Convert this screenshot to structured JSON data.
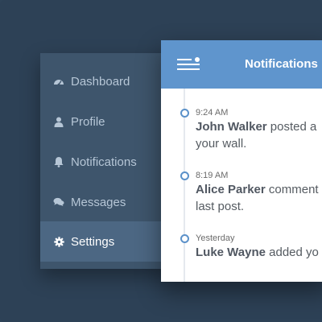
{
  "sidebar": {
    "items": [
      {
        "label": "Dashboard",
        "icon": "dashboard-icon",
        "active": false
      },
      {
        "label": "Profile",
        "icon": "user-icon",
        "active": false
      },
      {
        "label": "Notifications",
        "icon": "bell-icon",
        "active": false
      },
      {
        "label": "Messages",
        "icon": "chat-icon",
        "active": false
      },
      {
        "label": "Settings",
        "icon": "gear-icon",
        "active": true
      }
    ]
  },
  "panel": {
    "title": "Notifications",
    "menu_icon": "menu-icon",
    "entries": [
      {
        "time": "9:24 AM",
        "name": "John Walker",
        "text1": " posted a",
        "text2": "your wall."
      },
      {
        "time": "8:19 AM",
        "name": "Alice Parker",
        "text1": " comment",
        "text2": "last post."
      },
      {
        "time": "Yesterday",
        "name": "Luke Wayne",
        "text1": " added yo",
        "text2": ""
      }
    ]
  },
  "colors": {
    "background": "#2e4358",
    "sidebar": "#3e556c",
    "sidebar_active": "#4c6783",
    "header": "#5f95cd",
    "timeline_dot": "#5b91c9"
  }
}
